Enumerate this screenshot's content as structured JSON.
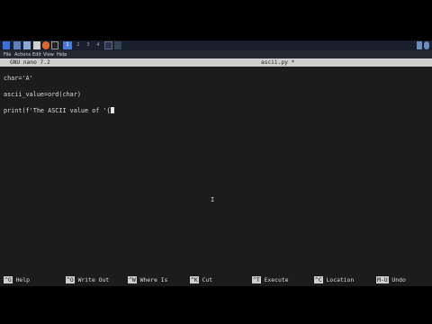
{
  "taskbar": {
    "workspaces": [
      "1",
      "2",
      "3",
      "4"
    ]
  },
  "menu": {
    "items": [
      "File",
      "Actions",
      "Edit",
      "View",
      "Help"
    ]
  },
  "nano": {
    "version": "GNU nano 7.2",
    "filename": "ascii.py *"
  },
  "code": {
    "line1": "char='A'",
    "line2": "ascii_value=ord(char)",
    "line3": "print(f'The ASCII value of '{"
  },
  "help_bar": [
    {
      "key": "^G",
      "label": "Help"
    },
    {
      "key": "^O",
      "label": "Write Out"
    },
    {
      "key": "^W",
      "label": "Where Is"
    },
    {
      "key": "^K",
      "label": "Cut"
    },
    {
      "key": "^T",
      "label": "Execute"
    },
    {
      "key": "^C",
      "label": "Location"
    },
    {
      "key": "M-U",
      "label": "Undo"
    }
  ],
  "colors": {
    "taskbar_bg": "#1a1f2c",
    "terminal_bg": "#1c1c1c",
    "title_bg": "#cfcfcf"
  }
}
